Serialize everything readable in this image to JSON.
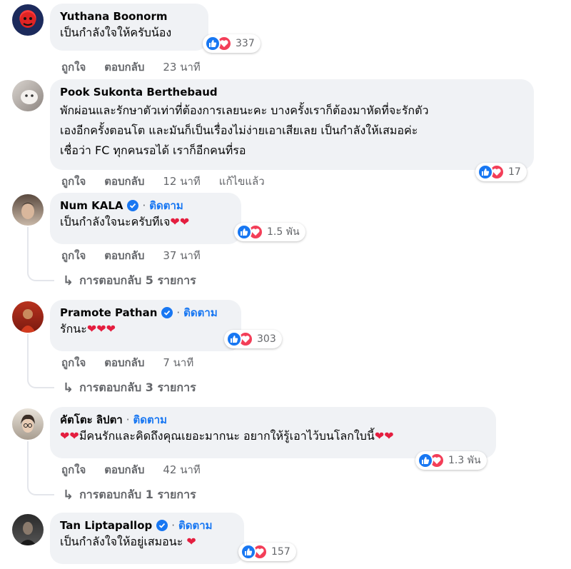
{
  "ui": {
    "like_label": "ถูกใจ",
    "reply_label": "ตอบกลับ",
    "follow_label": "ติดตาม",
    "dot": "·",
    "reply_arrow": "↳"
  },
  "icons": {
    "like": "thumbs-up-icon",
    "love": "heart-icon",
    "verified": "verified-badge-icon"
  },
  "colors": {
    "accent": "#1877f2",
    "love": "#f33e58",
    "heart_emoji": "#e41e3f",
    "bubble": "#f0f2f5",
    "muted": "#65676b"
  },
  "comments": [
    {
      "author": "Yuthana Boonorm",
      "text": "เป็นกำลังใจให้ครับน้อง",
      "reactions": "337",
      "time": "23 นาที"
    },
    {
      "author": "Pook Sukonta Berthebaud",
      "text": "พักผ่อนและรักษาตัวเท่าที่ต้องการเลยนะคะ บางครั้งเราก็ต้องมาหัดที่จะรักตัว\nเองอีกครั้งตอนโต และมันก็เป็นเรื่องไม่ง่ายเอาเสียเลย เป็นกำลังให้เสมอค่ะ\nเชื่อว่า FC ทุกคนรอได้ เราก็อีกคนที่รอ",
      "reactions": "17",
      "time": "12 นาที",
      "edited": "แก้ไขแล้ว"
    },
    {
      "author": "Num KALA",
      "text": "เป็นกำลังใจนะครับทีเจ",
      "emoji": "❤❤",
      "reactions": "1.5 พัน",
      "time": "37 นาที",
      "replies": "การตอบกลับ 5 รายการ"
    },
    {
      "author": "Pramote Pathan",
      "text": "รักนะ",
      "emoji": "❤❤❤",
      "reactions": "303",
      "time": "7 นาที",
      "replies": "การตอบกลับ 3 รายการ"
    },
    {
      "author": "คัตโตะ ลิปตา",
      "emoji_pre": "❤❤",
      "text": "มีคนรักและคิดถึงคุณเยอะมากนะ อยากให้รู้เอาไว้บนโลกใบนี้",
      "emoji": "❤❤",
      "reactions": "1.3 พัน",
      "time": "42 นาที",
      "replies": "การตอบกลับ 1 รายการ"
    },
    {
      "author": "Tan Liptapallop",
      "text": "เป็นกำลังใจให้อยู่เสมอนะ ",
      "emoji": "❤",
      "reactions": "157"
    }
  ]
}
